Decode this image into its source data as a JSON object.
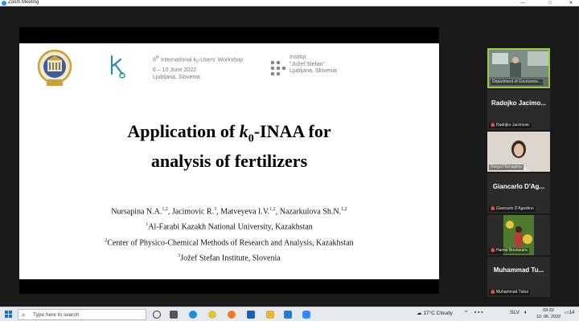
{
  "window": {
    "title": "Zoom Meeting",
    "controls": {
      "minimize": "—",
      "maximize": "□",
      "close": "✕"
    }
  },
  "slide": {
    "title_pre": "Application of ",
    "title_k": "k",
    "title_sub": "0",
    "title_post": "-INAA for",
    "title_line2": "analysis of fertilizers",
    "workshop_line1_a": "8",
    "workshop_line1_sup": "th",
    "workshop_line1_b": " International ",
    "workshop_line1_k": "k",
    "workshop_line1_sub": "0",
    "workshop_line1_c": "-Users' Workshop",
    "workshop_line2": "6 – 10 June 2022",
    "workshop_line3": "Ljubljana, Slovenia",
    "institute_line1": "Institut",
    "institute_line2": "\"Jožef Stefan\"",
    "institute_line3": "Ljubljana, Slovenia",
    "authors": [
      {
        "name": "Nursapina N.A.",
        "aff": "1,2",
        "sep": ", "
      },
      {
        "name": "Jacimovic R.",
        "aff": "3",
        "sep": ", "
      },
      {
        "name": "Matveyeva I.V.",
        "aff": "1,2",
        "sep": ", "
      },
      {
        "name": "Nazarkulova Sh.N.",
        "aff": "1,2",
        "sep": ""
      }
    ],
    "affiliations": [
      {
        "num": "1",
        "text": "Al-Farabi Kazakh National University, Kazakhstan"
      },
      {
        "num": "2",
        "text": "Center of Physico-Chemical Methods of Research and Analysis, Kazakhstan"
      },
      {
        "num": "3",
        "text": "Jožef Stefan Institute, Slovenia"
      }
    ]
  },
  "participants": [
    {
      "display": "",
      "tag": "Department of Environme...",
      "type": "video-room"
    },
    {
      "display": "Radojko Jacimo...",
      "tag": "Radojko Jacimovic",
      "type": "name"
    },
    {
      "display": "",
      "tag": "Nurgul Nursapina",
      "type": "video-person"
    },
    {
      "display": "Giancarlo D'Ag...",
      "tag": "Giancarlo D'Agostino",
      "type": "name"
    },
    {
      "display": "",
      "tag": "Hamid Bounouira",
      "type": "video-outdoor"
    },
    {
      "display": "Muhammad Tu...",
      "tag": "Muhammad Tukur",
      "type": "name"
    }
  ],
  "taskbar": {
    "search_placeholder": "Type here to search",
    "weather": "17°C  Cloudy",
    "language": "SLV",
    "time": "09:32",
    "date": "10. 06. 2022",
    "notification_count": "14"
  },
  "colors": {
    "zoom_blue": "#2d8cff",
    "mic_muted_red": "#e24b4b",
    "active_speaker_border": "#9ccc3c"
  }
}
